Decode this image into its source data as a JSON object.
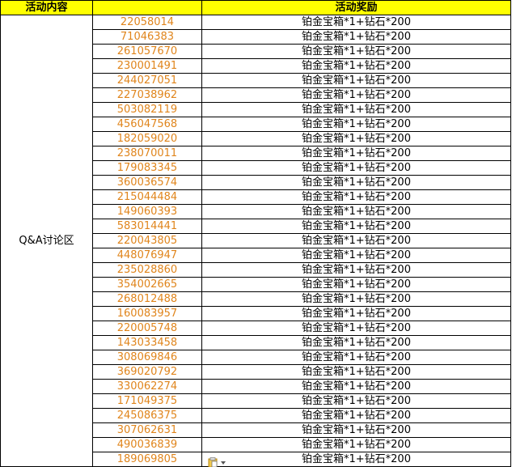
{
  "header": {
    "activity": "活动内容",
    "uid": "",
    "reward": "活动奖励"
  },
  "activity_name": "Q&A讨论区",
  "rows": [
    {
      "uid": "22058014",
      "reward": "铂金宝箱*1+钻石*200"
    },
    {
      "uid": "71046383",
      "reward": "铂金宝箱*1+钻石*200"
    },
    {
      "uid": "261057670",
      "reward": "铂金宝箱*1+钻石*200"
    },
    {
      "uid": "230001491",
      "reward": "铂金宝箱*1+钻石*200"
    },
    {
      "uid": "244027051",
      "reward": "铂金宝箱*1+钻石*200"
    },
    {
      "uid": "227038962",
      "reward": "铂金宝箱*1+钻石*200"
    },
    {
      "uid": "503082119",
      "reward": "铂金宝箱*1+钻石*200"
    },
    {
      "uid": "456047568",
      "reward": "铂金宝箱*1+钻石*200"
    },
    {
      "uid": "182059020",
      "reward": "铂金宝箱*1+钻石*200"
    },
    {
      "uid": "238070011",
      "reward": "铂金宝箱*1+钻石*200"
    },
    {
      "uid": "179083345",
      "reward": "铂金宝箱*1+钻石*200"
    },
    {
      "uid": "360036574",
      "reward": "铂金宝箱*1+钻石*200"
    },
    {
      "uid": "215044484",
      "reward": "铂金宝箱*1+钻石*200"
    },
    {
      "uid": "149060393",
      "reward": "铂金宝箱*1+钻石*200"
    },
    {
      "uid": "583014441",
      "reward": "铂金宝箱*1+钻石*200"
    },
    {
      "uid": "220043805",
      "reward": "铂金宝箱*1+钻石*200"
    },
    {
      "uid": "448076947",
      "reward": "铂金宝箱*1+钻石*200"
    },
    {
      "uid": "235028860",
      "reward": "铂金宝箱*1+钻石*200"
    },
    {
      "uid": "354002665",
      "reward": "铂金宝箱*1+钻石*200"
    },
    {
      "uid": "268012488",
      "reward": "铂金宝箱*1+钻石*200"
    },
    {
      "uid": "160083957",
      "reward": "铂金宝箱*1+钻石*200"
    },
    {
      "uid": "220005748",
      "reward": "铂金宝箱*1+钻石*200"
    },
    {
      "uid": "143033458",
      "reward": "铂金宝箱*1+钻石*200"
    },
    {
      "uid": "308069846",
      "reward": "铂金宝箱*1+钻石*200"
    },
    {
      "uid": "369020792",
      "reward": "铂金宝箱*1+钻石*200"
    },
    {
      "uid": "330062274",
      "reward": "铂金宝箱*1+钻石*200"
    },
    {
      "uid": "171049375",
      "reward": "铂金宝箱*1+钻石*200"
    },
    {
      "uid": "245086375",
      "reward": "铂金宝箱*1+钻石*200"
    },
    {
      "uid": "307062631",
      "reward": "铂金宝箱*1+钻石*200"
    },
    {
      "uid": "490036839",
      "reward": "铂金宝箱*1+钻石*200"
    },
    {
      "uid": "189069805",
      "reward": "铂金宝箱*1+钻石*200"
    }
  ],
  "colors": {
    "header_bg": "#ffff00",
    "uid_text": "#e0851c",
    "grid": "#000000"
  },
  "icons": {
    "paste_options": "paste-options-icon"
  }
}
